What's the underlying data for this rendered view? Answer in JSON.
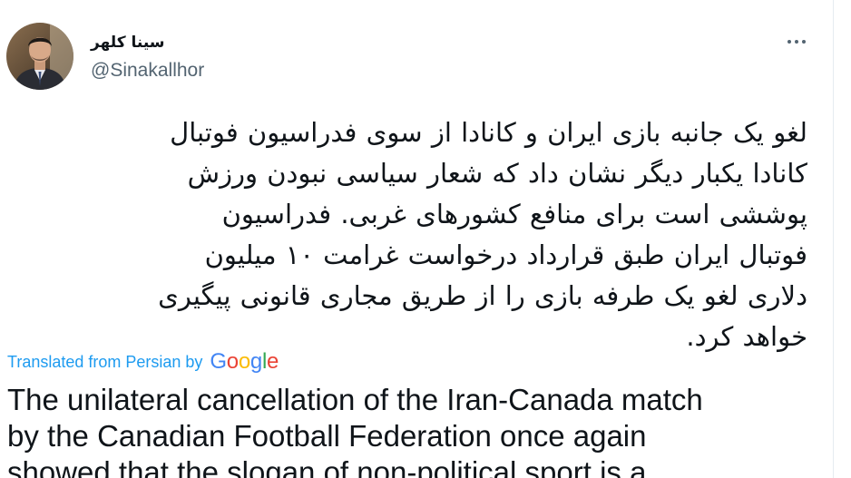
{
  "tweet": {
    "author": {
      "display_name": "سینا کلهر",
      "handle": "@Sinakallhor",
      "avatar_icon": "profile-photo"
    },
    "more_icon": "ellipsis-icon",
    "persian_lines": [
      "لغو یک جانبه بازی ایران و کانادا از سوی فدراسیون فوتبال",
      "کانادا یکبار دیگر نشان داد که شعار سیاسی نبودن ورزش",
      "پوششی است برای منافع کشورهای غربی. فدراسیون",
      "فوتبال ایران طبق قرارداد درخواست غرامت ۱۰ میلیون",
      "دلاری لغو یک طرفه بازی را از طریق مجاری قانونی پیگیری",
      "خواهد کرد."
    ],
    "translation": {
      "label": "Translated from Persian by",
      "provider": "Google",
      "lines": [
        "The unilateral cancellation of the Iran-Canada match",
        "by the Canadian Football Federation once again",
        "showed that the slogan of non-political sport is a"
      ]
    },
    "colors": {
      "link_blue": "#1d9bf0",
      "secondary_text": "#536471",
      "primary_text": "#0f1419"
    }
  }
}
